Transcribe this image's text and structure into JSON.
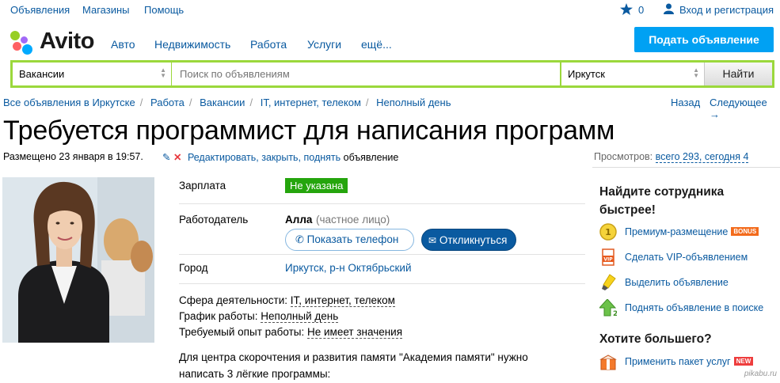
{
  "topbar": {
    "links": [
      "Объявления",
      "Магазины",
      "Помощь"
    ],
    "favorites_count": "0",
    "login_label": "Вход и регистрация"
  },
  "header": {
    "logo_text": "Avito",
    "nav": [
      "Авто",
      "Недвижимость",
      "Работа",
      "Услуги",
      "ещё..."
    ],
    "post_button": "Подать объявление"
  },
  "search": {
    "category": "Вакансии",
    "placeholder": "Поиск по объявлениям",
    "city": "Иркутск",
    "find_button": "Найти"
  },
  "breadcrumbs": [
    "Все объявления в Иркутске",
    "Работа",
    "Вакансии",
    "IT, интернет, телеком",
    "Неполный день"
  ],
  "crumb_nav": {
    "back": "Назад",
    "next": "Следующее →"
  },
  "ad": {
    "title": "Требуется программист для написания программ",
    "posted": "Размещено 23 января в 19:57.",
    "edit_link": "Редактировать, закрыть, поднять",
    "edit_suffix": "объявление",
    "views_label": "Просмотров:",
    "views_value": "всего 293, сегодня 4",
    "salary_label": "Зарплата",
    "salary_value": "Не указана",
    "employer_label": "Работодатель",
    "employer_name": "Алла",
    "employer_type": "(частное лицо)",
    "phone_button": "Показать телефон",
    "respond_button": "Откликнуться",
    "city_label": "Город",
    "city_value": "Иркутск, р-н Октябрьский",
    "sphere_label": "Сфера деятельности:",
    "sphere_value": "IT, интернет, телеком",
    "schedule_label": "График работы:",
    "schedule_value": "Неполный день",
    "experience_label": "Требуемый опыт работы:",
    "experience_value": "Не имеет значения",
    "description": "Для центра скорочтения и развития памяти \"Академия памяти\" нужно написать 3 лёгкие программы:"
  },
  "sidebar": {
    "promo_title": "Найдите сотрудника быстрее!",
    "services": [
      {
        "label": "Премиум-размещение",
        "tag": "BONUS",
        "icon": "premium-coin-icon"
      },
      {
        "label": "Сделать VIP-объявлением",
        "icon": "vip-icon"
      },
      {
        "label": "Выделить объявление",
        "icon": "highlighter-icon"
      },
      {
        "label": "Поднять объявление в поиске",
        "icon": "lift-arrow-icon"
      }
    ],
    "more_title": "Хотите большего?",
    "package_label": "Применить пакет услуг",
    "package_tag": "NEW"
  },
  "watermark": "pikabu.ru",
  "colors": {
    "link": "#0a5aa0",
    "accent_blue": "#00a1f3",
    "search_border": "#9bd83c",
    "salary_badge": "#25a50d",
    "bonus_tag": "#f36b1c",
    "new_tag": "#ee3d3d"
  }
}
